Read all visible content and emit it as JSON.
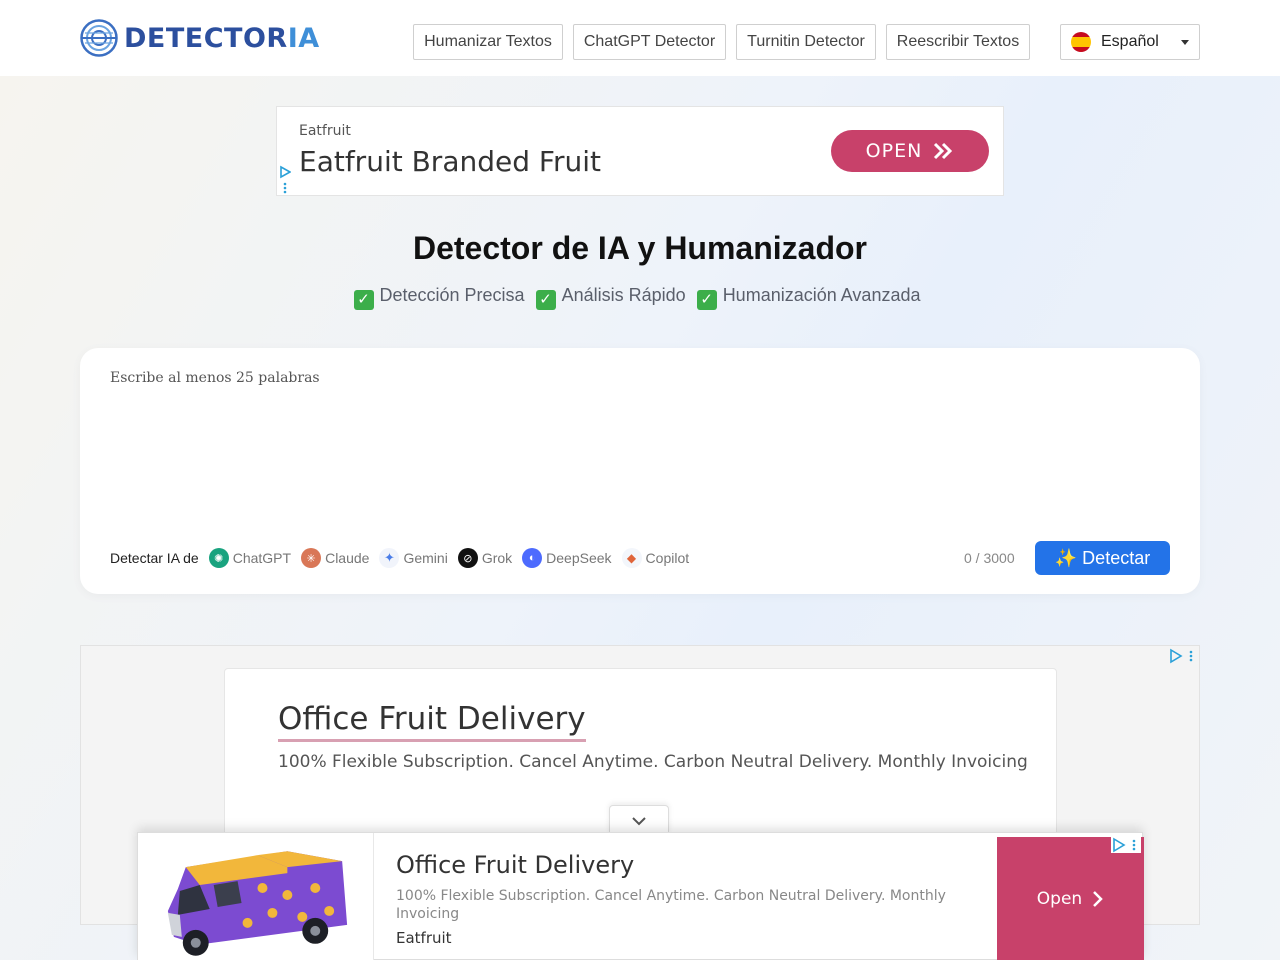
{
  "header": {
    "logo_main": "DETECTOR",
    "logo_accent": "IA",
    "nav": [
      "Humanizar Textos",
      "ChatGPT Detector",
      "Turnitin Detector",
      "Reescribir Textos"
    ],
    "language": "Español"
  },
  "top_ad": {
    "advertiser": "Eatfruit",
    "headline": "Eatfruit Branded Fruit",
    "button": "OPEN"
  },
  "hero": {
    "title": "Detector de IA y Humanizador",
    "features": [
      "Detección Precisa",
      "Análisis Rápido",
      "Humanización Avanzada"
    ]
  },
  "detector": {
    "placeholder": "Escribe al menos 25 palabras",
    "models_label": "Detectar IA de",
    "models": [
      "ChatGPT",
      "Claude",
      "Gemini",
      "Grok",
      "DeepSeek",
      "Copilot"
    ],
    "counter": "0 / 3000",
    "button": "✨ Detectar"
  },
  "bottom_ad": {
    "title": "Office Fruit Delivery",
    "description": "100% Flexible Subscription. Cancel Anytime. Carbon Neutral Delivery. Monthly Invoicing"
  },
  "sticky_ad": {
    "title": "Office Fruit Delivery",
    "description": "100% Flexible Subscription. Cancel Anytime. Carbon Neutral Delivery. Monthly Invoicing",
    "advertiser": "Eatfruit",
    "button": "Open"
  },
  "colors": {
    "primary_button": "#2373e8",
    "ad_accent": "#c8416a",
    "logo_dark": "#2c4f9e",
    "logo_light": "#3f8fd8"
  }
}
